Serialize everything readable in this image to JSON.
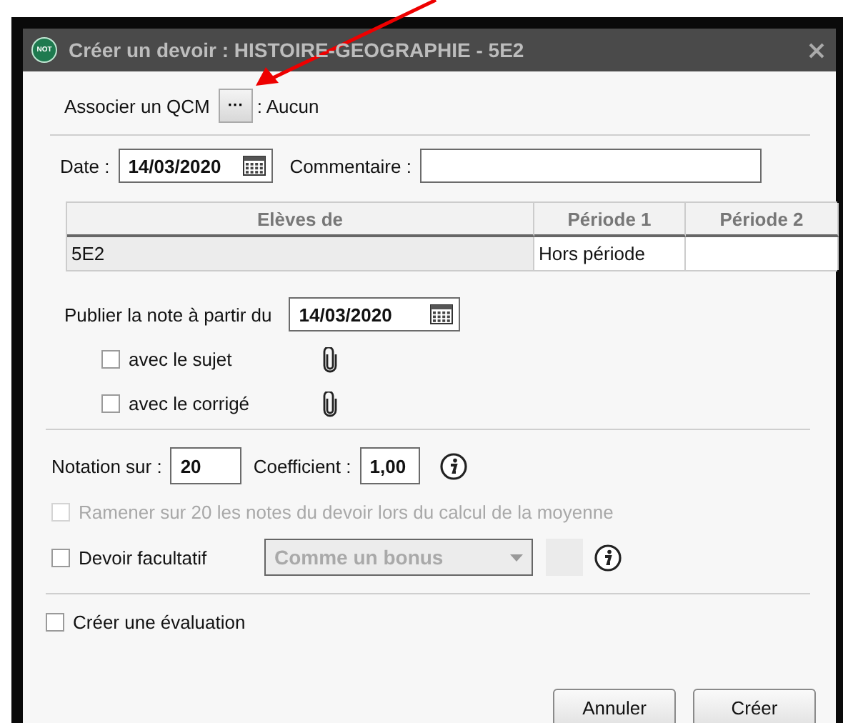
{
  "window": {
    "logo": "NOT",
    "title": "Créer un devoir : HISTOIRE-GEOGRAPHIE - 5E2"
  },
  "qcm": {
    "label": "Associer un QCM",
    "button": "···",
    "value": ": Aucun"
  },
  "date": {
    "label": "Date :",
    "value": "14/03/2020"
  },
  "comment": {
    "label": "Commentaire :"
  },
  "table": {
    "columns": [
      "Elèves de",
      "Période 1",
      "Période 2"
    ],
    "rows": [
      {
        "cells": [
          "5E2",
          "Hors période"
        ]
      }
    ]
  },
  "publish": {
    "label": "Publier la note à partir du",
    "value": "14/03/2020",
    "options": [
      {
        "label": "avec le sujet",
        "checked": false
      },
      {
        "label": "avec le corrigé",
        "checked": false
      }
    ]
  },
  "notation": {
    "label": "Notation sur :",
    "value": "20"
  },
  "coefficient": {
    "label": "Coefficient :",
    "value": "1,00"
  },
  "rescale": {
    "label": "Ramener sur 20 les notes du devoir lors du calcul de la moyenne",
    "checked": false,
    "disabled": true
  },
  "optional": {
    "label": "Devoir facultatif",
    "checked": false,
    "mode": {
      "value": "Comme un bonus",
      "disabled": true
    }
  },
  "evaluation": {
    "label": "Créer une évaluation",
    "checked": false
  },
  "buttons": [
    "Annuler",
    "Créer"
  ]
}
